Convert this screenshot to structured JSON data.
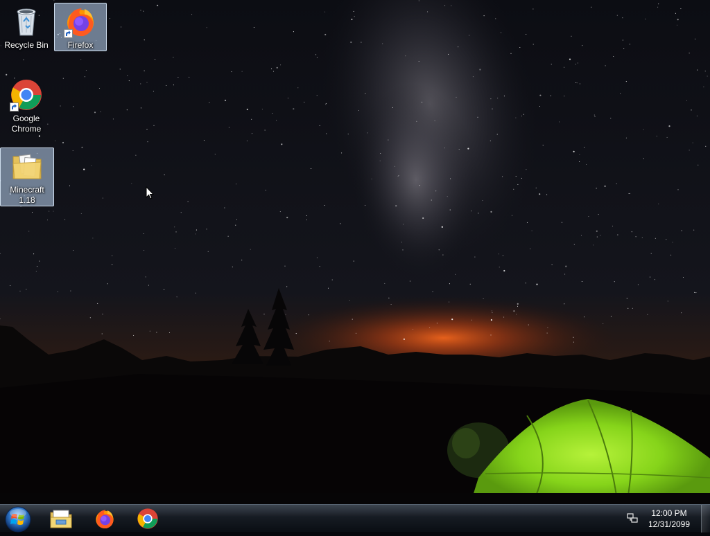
{
  "desktop": {
    "icons": [
      {
        "label_lines": [
          "Recycle Bin"
        ],
        "icon": "recycle-bin-icon",
        "selected": false
      },
      {
        "label_lines": [
          "Firefox"
        ],
        "icon": "firefox-icon",
        "selected": true
      },
      {
        "label_lines": [
          "Google",
          "Chrome"
        ],
        "icon": "chrome-icon",
        "selected": false
      },
      {
        "label_lines": [
          "Minecraft",
          "1.18"
        ],
        "icon": "folder-icon",
        "selected": true
      }
    ]
  },
  "taskbar": {
    "start_icon": "windows-start-orb-icon",
    "pinned": [
      {
        "name": "File Explorer",
        "icon": "file-explorer-icon"
      },
      {
        "name": "Firefox",
        "icon": "firefox-icon"
      },
      {
        "name": "Google Chrome",
        "icon": "chrome-icon"
      }
    ],
    "tray": {
      "network_icon": "network-icon",
      "time": "12:00 PM",
      "date": "12/31/2099"
    }
  },
  "colors": {
    "sky": "#07080d",
    "glow": "#d8561a",
    "tent": "#8edc1e",
    "selection": "#bed7f5"
  }
}
